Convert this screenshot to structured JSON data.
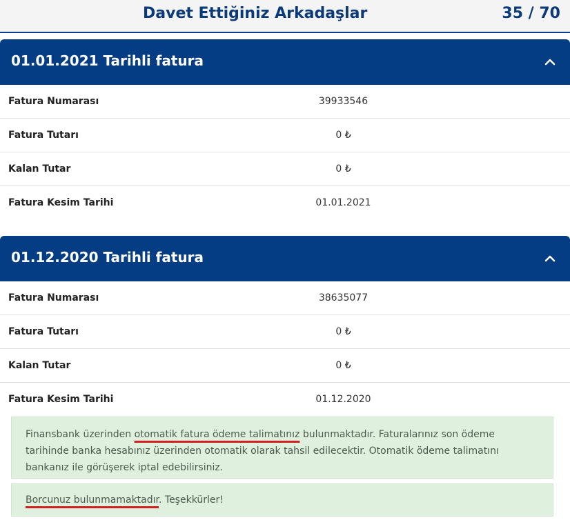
{
  "header": {
    "title": "Davet Ettiğiniz Arkadaşlar",
    "count": "35 / 70"
  },
  "invoices": [
    {
      "title": "01.01.2021 Tarihli fatura",
      "rows": [
        {
          "label": "Fatura Numarası",
          "value": "39933546"
        },
        {
          "label": "Fatura Tutarı",
          "value": "0 ₺"
        },
        {
          "label": "Kalan Tutar",
          "value": "0 ₺"
        },
        {
          "label": "Fatura Kesim Tarihi",
          "value": "01.01.2021"
        }
      ]
    },
    {
      "title": "01.12.2020 Tarihli fatura",
      "rows": [
        {
          "label": "Fatura Numarası",
          "value": "38635077"
        },
        {
          "label": "Fatura Tutarı",
          "value": "0 ₺"
        },
        {
          "label": "Kalan Tutar",
          "value": "0 ₺"
        },
        {
          "label": "Fatura Kesim Tarihi",
          "value": "01.12.2020"
        }
      ]
    }
  ],
  "alerts": {
    "autopay_prefix": "Finansbank üzerinden ",
    "autopay_highlight": "otomatik fatura ödeme talimatınız",
    "autopay_suffix": " bulunmaktadır. Faturalarınız son ödeme tarihinde banka hesabınız üzerinden otomatik olarak tahsil edilecektir. Otomatik ödeme talimatını bankanız ile görüşerek iptal edebilirsiniz.",
    "debt_highlight": "Borcunuz bulunmamaktadır",
    "debt_suffix": ". Teşekkürler!"
  },
  "colors": {
    "brand_blue": "#053d85",
    "alert_green": "#dff0df",
    "annotation_red": "#d21f1f"
  }
}
